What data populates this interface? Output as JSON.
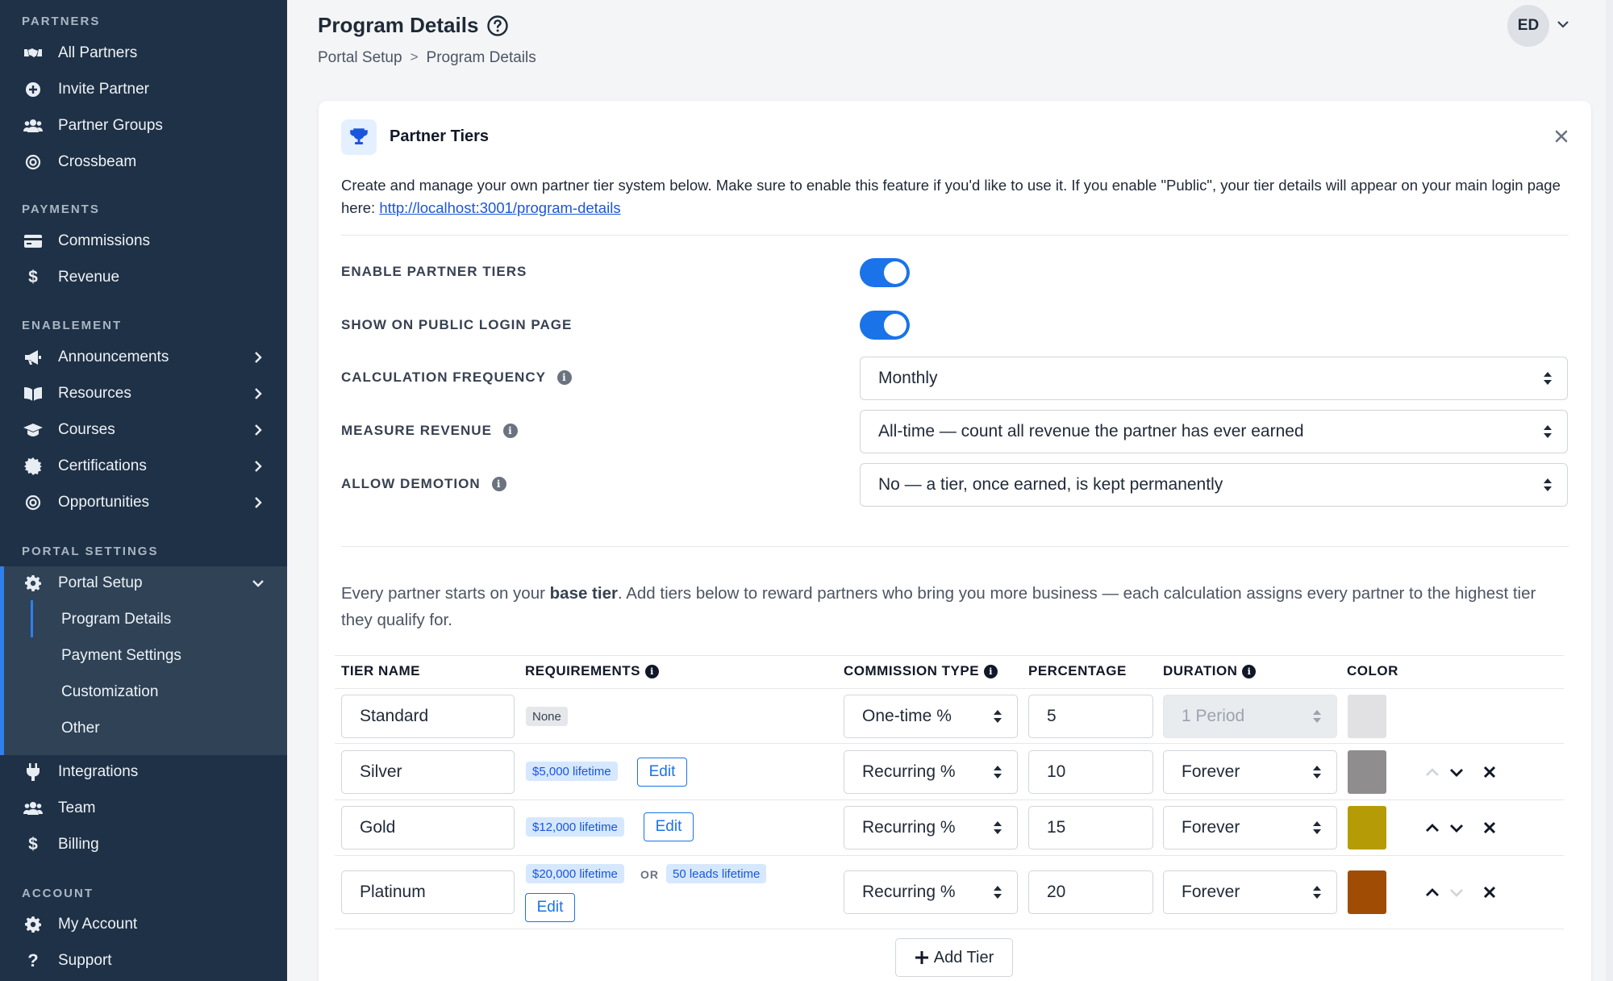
{
  "sidebar": {
    "sections": [
      {
        "title": "PARTNERS"
      },
      {
        "title": "PAYMENTS"
      },
      {
        "title": "ENABLEMENT"
      },
      {
        "title": "PORTAL SETTINGS"
      },
      {
        "title": "ACCOUNT"
      }
    ],
    "items": {
      "all_partners": "All Partners",
      "invite_partner": "Invite Partner",
      "partner_groups": "Partner Groups",
      "crossbeam": "Crossbeam",
      "commissions": "Commissions",
      "revenue": "Revenue",
      "announcements": "Announcements",
      "resources": "Resources",
      "courses": "Courses",
      "certifications": "Certifications",
      "opportunities": "Opportunities",
      "portal_setup": "Portal Setup",
      "program_details": "Program Details",
      "payment_settings": "Payment Settings",
      "customization": "Customization",
      "other": "Other",
      "integrations": "Integrations",
      "team": "Team",
      "billing": "Billing",
      "my_account": "My Account",
      "support": "Support"
    }
  },
  "header": {
    "title": "Program Details",
    "breadcrumb": [
      "Portal Setup",
      ">",
      "Program Details"
    ],
    "avatar_initials": "ED"
  },
  "card": {
    "title": "Partner Tiers",
    "description": "Create and manage your own partner tier system below. Make sure to enable this feature if you'd like to use it. If you enable \"Public\", your tier details will appear on your main login page here: ",
    "link": "http://localhost:3001/program-details",
    "settings": {
      "enable_label": "ENABLE PARTNER TIERS",
      "enable_on": true,
      "public_label": "SHOW ON PUBLIC LOGIN PAGE",
      "public_on": true,
      "frequency_label": "CALCULATION FREQUENCY",
      "frequency_value": "Monthly",
      "measure_label": "MEASURE REVENUE",
      "measure_value": "All-time — count all revenue the partner has ever earned",
      "demotion_label": "ALLOW DEMOTION",
      "demotion_value": "No — a tier, once earned, is kept permanently"
    },
    "intro_pre": "Every partner starts on your ",
    "intro_bold": "base tier",
    "intro_post": ". Add tiers below to reward partners who bring you more business — each calculation assigns every partner to the highest tier they qualify for.",
    "table": {
      "headers": {
        "name": "TIER NAME",
        "requirements": "REQUIREMENTS",
        "commission_type": "COMMISSION TYPE",
        "percentage": "PERCENTAGE",
        "duration": "DURATION",
        "color": "COLOR"
      },
      "rows": [
        {
          "name": "Standard",
          "req": [
            "None"
          ],
          "or_text": "",
          "edit": "",
          "type": "One-time %",
          "pct": "5",
          "duration": "1 Period",
          "color": "#e1e1e3"
        },
        {
          "name": "Silver",
          "req": [
            "$5,000 lifetime"
          ],
          "or_text": "",
          "edit": "Edit",
          "type": "Recurring %",
          "pct": "10",
          "duration": "Forever",
          "color": "#8f8d8d"
        },
        {
          "name": "Gold",
          "req": [
            "$12,000 lifetime"
          ],
          "or_text": "",
          "edit": "Edit",
          "type": "Recurring %",
          "pct": "15",
          "duration": "Forever",
          "color": "#b59c06"
        },
        {
          "name": "Platinum",
          "req": [
            "$20,000 lifetime",
            "50 leads lifetime"
          ],
          "or_text": "OR",
          "edit": "Edit",
          "type": "Recurring %",
          "pct": "20",
          "duration": "Forever",
          "color": "#a14c05"
        }
      ]
    },
    "add_tier_label": "Add Tier"
  },
  "colors": {
    "sidebar_bg": "#1f3146",
    "accent": "#1a73e8"
  }
}
